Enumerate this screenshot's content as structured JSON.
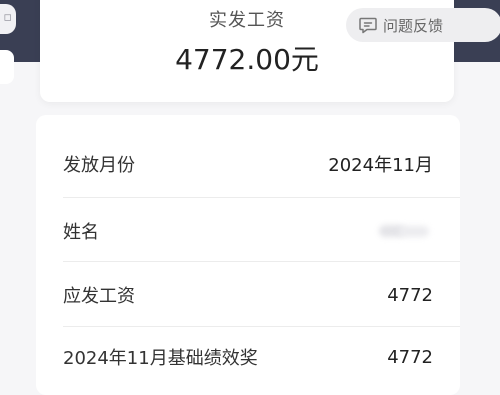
{
  "summary": {
    "label": "实发工资",
    "amount": "4772.00元"
  },
  "feedback": {
    "label": "问题反馈",
    "icon": "chat-bubble-icon"
  },
  "details": [
    {
      "label": "发放月份",
      "value": "2024年11月"
    },
    {
      "label": "姓名",
      "value": ""
    },
    {
      "label": "应发工资",
      "value": "4772"
    },
    {
      "label": "2024年11月基础绩效奖",
      "value": "4772"
    }
  ],
  "colors": {
    "top_band": "#3a3f54",
    "page_bg": "#f6f6f8",
    "card_bg": "#ffffff",
    "divider": "#ececec"
  }
}
